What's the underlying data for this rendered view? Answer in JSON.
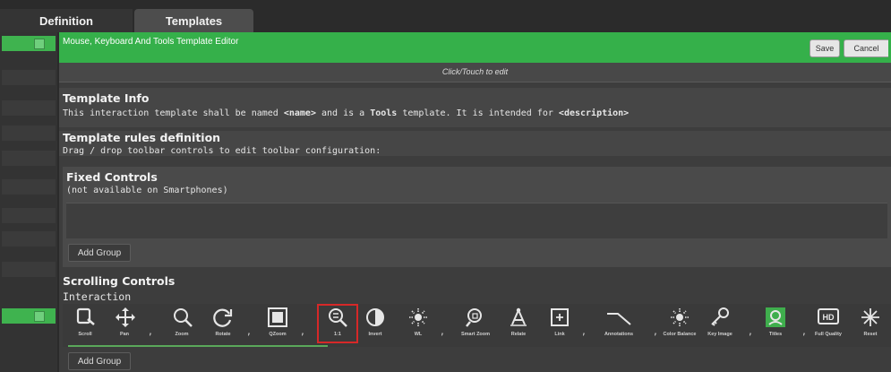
{
  "tabs": [
    "Definition",
    "Templates"
  ],
  "editor": {
    "title": "Mouse, Keyboard And Tools Template Editor",
    "save": "Save",
    "cancel": "Cancel",
    "click_hint": "Click/Touch to edit"
  },
  "template_info": {
    "title": "Template Info",
    "p1": "This interaction template shall be named ",
    "name": "<name>",
    "p2": " and is a ",
    "type": "Tools",
    "p3": " template. It is intended for ",
    "desc": "<description>"
  },
  "rules": {
    "title": "Template rules definition",
    "text": "Drag / drop toolbar controls to edit toolbar configuration:"
  },
  "fixed_controls": {
    "title": "Fixed Controls",
    "note": "(not available on Smartphones)",
    "add_group": "Add Group"
  },
  "scrolling_controls": {
    "title": "Scrolling Controls",
    "group_name": "Interaction",
    "add_group": "Add Group",
    "tools": [
      {
        "label": "Scroll",
        "icon": "scroll-icon"
      },
      {
        "label": "Pan",
        "icon": "pan-icon"
      },
      {
        "label": "Zoom",
        "icon": "zoom-icon"
      },
      {
        "label": "Rotate",
        "icon": "rotate-icon"
      },
      {
        "label": "QZoom",
        "icon": "qzoom-icon"
      },
      {
        "label": "1:1",
        "icon": "one-to-one-icon",
        "highlighted": true
      },
      {
        "label": "Invert",
        "icon": "invert-icon"
      },
      {
        "label": "WL",
        "icon": "window-level-icon"
      },
      {
        "label": "Smart Zoom",
        "icon": "smart-zoom-icon"
      },
      {
        "label": "Relate",
        "icon": "relate-icon"
      },
      {
        "label": "Link",
        "icon": "link-icon"
      },
      {
        "label": "Annotations",
        "icon": "annotations-icon"
      },
      {
        "label": "Color Balance",
        "icon": "color-balance-icon"
      },
      {
        "label": "Key Image",
        "icon": "key-image-icon"
      },
      {
        "label": "Titles",
        "icon": "titles-icon"
      },
      {
        "label": "Full Quality",
        "icon": "full-quality-icon",
        "badge": "HD"
      },
      {
        "label": "Reset",
        "icon": "reset-icon"
      }
    ]
  },
  "colors": {
    "accent_green": "#35b04a",
    "highlight_red": "#d62828",
    "panel_bg": "#3d3d3d"
  }
}
